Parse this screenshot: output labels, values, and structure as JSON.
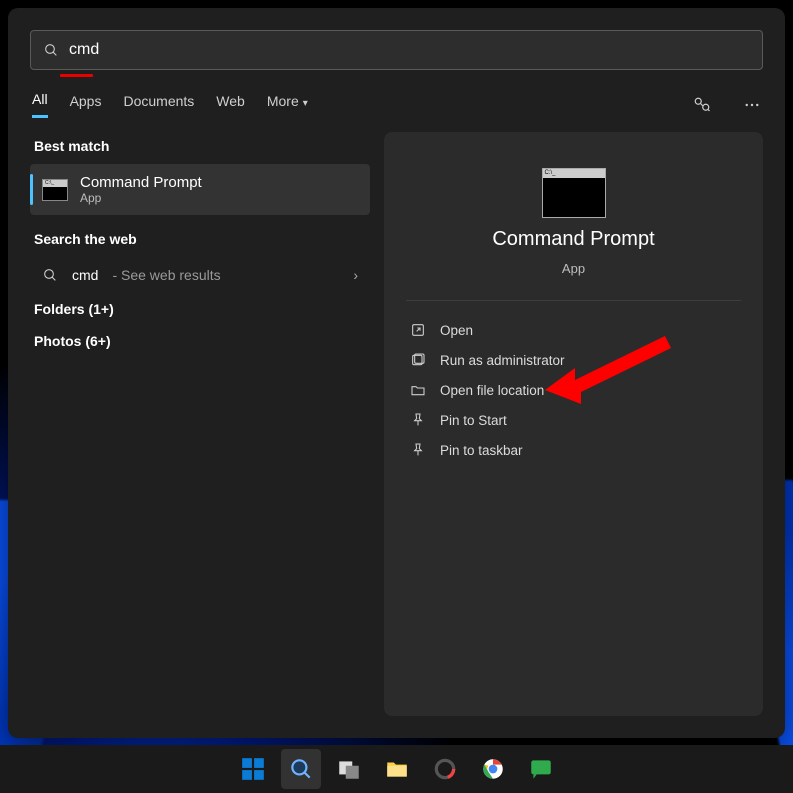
{
  "search": {
    "value": "cmd"
  },
  "tabs": {
    "all": "All",
    "apps": "Apps",
    "documents": "Documents",
    "web": "Web",
    "more": "More"
  },
  "left": {
    "best_match": "Best match",
    "result_title": "Command Prompt",
    "result_sub": "App",
    "search_web_header": "Search the web",
    "web_query": "cmd",
    "web_suffix": " - See web results",
    "folders": "Folders (1+)",
    "photos": "Photos (6+)"
  },
  "preview": {
    "title": "Command Prompt",
    "sub": "App"
  },
  "actions": {
    "open": "Open",
    "run_admin": "Run as administrator",
    "open_loc": "Open file location",
    "pin_start": "Pin to Start",
    "pin_taskbar": "Pin to taskbar"
  }
}
